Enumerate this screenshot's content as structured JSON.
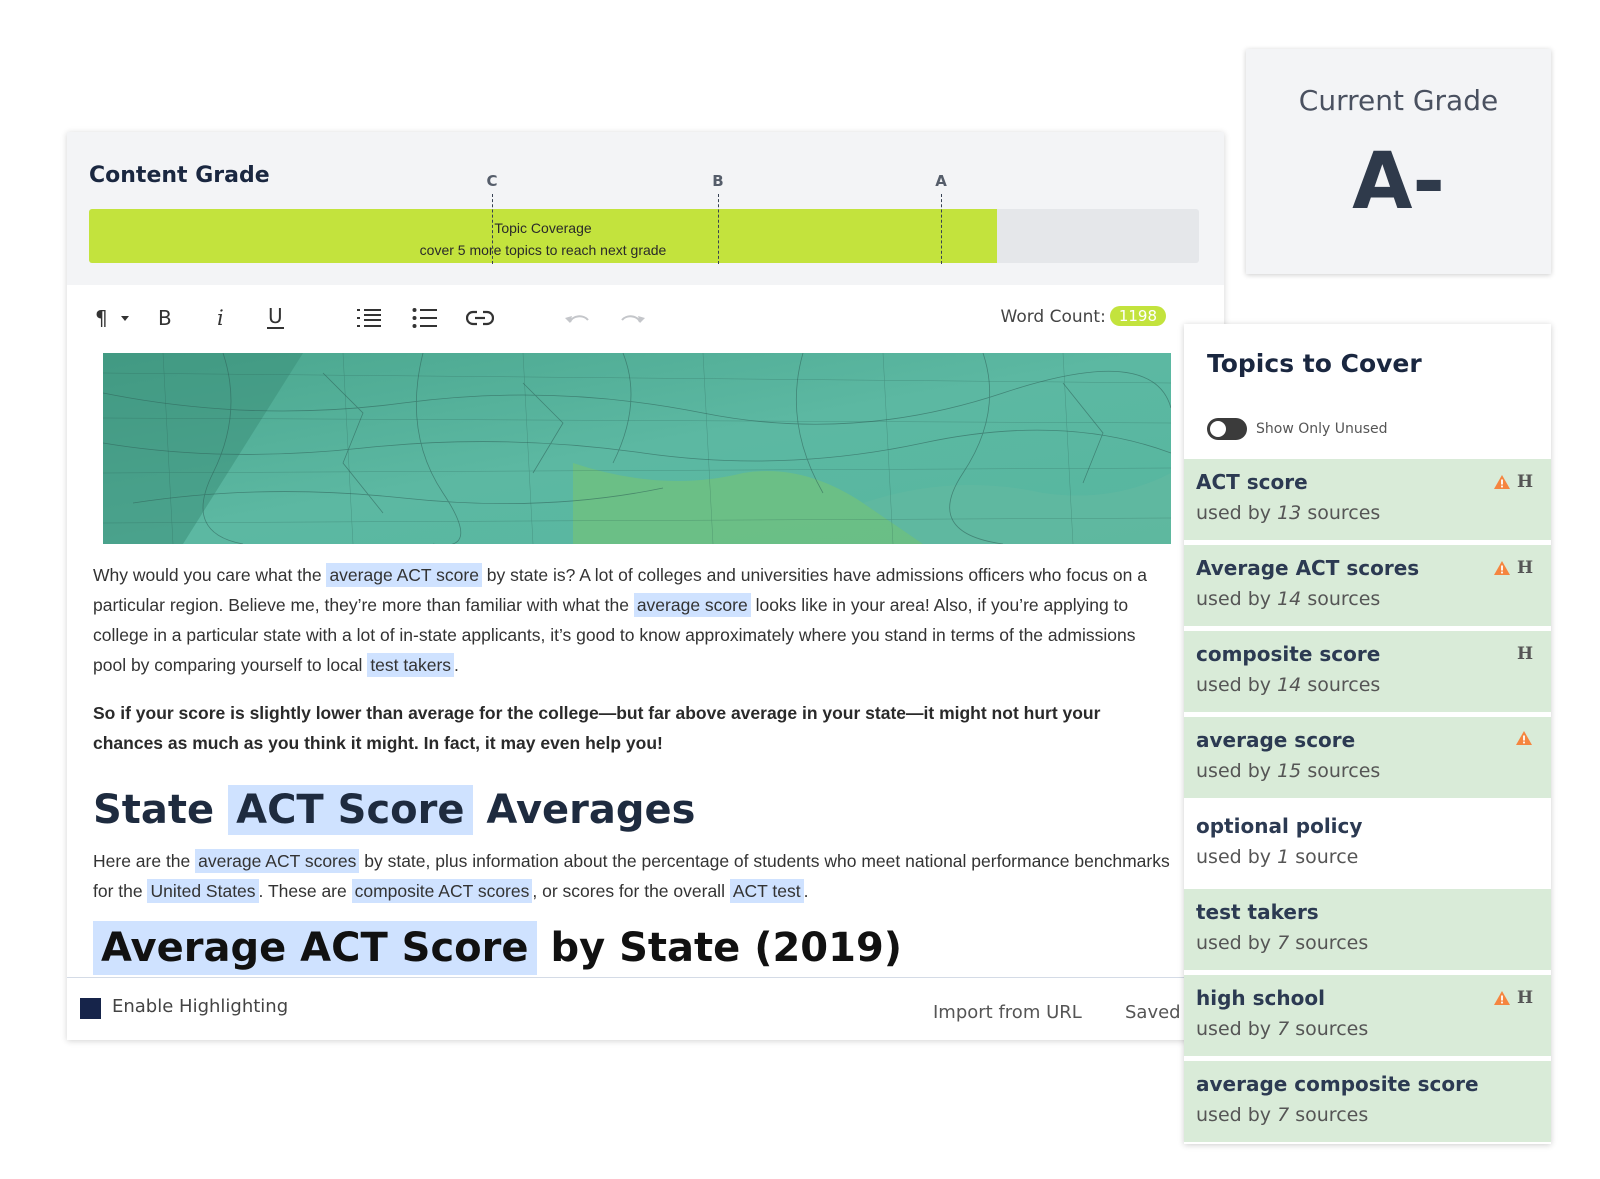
{
  "content_grade": {
    "title": "Content Grade",
    "markers": [
      {
        "label": "C"
      },
      {
        "label": "B"
      },
      {
        "label": "A"
      }
    ],
    "bar": {
      "label": "Topic Coverage",
      "sublabel": "cover 5 more topics to reach next grade",
      "fill_percent": 81.8,
      "color": "#c3e33d"
    }
  },
  "toolbar": {
    "paragraph_icon": "paragraph-icon",
    "buttons": [
      {
        "name": "bold-icon",
        "glyph": "B"
      },
      {
        "name": "italic-icon",
        "glyph": "i"
      },
      {
        "name": "underline-icon",
        "glyph": "U"
      },
      {
        "name": "ordered-list-icon"
      },
      {
        "name": "bulleted-list-icon"
      },
      {
        "name": "link-icon"
      },
      {
        "name": "undo-icon"
      },
      {
        "name": "redo-icon"
      }
    ],
    "word_count_label": "Word Count:",
    "word_count": "1198"
  },
  "article": {
    "intro": {
      "t1": "Why would you care what the ",
      "h1": "average ACT score",
      "t2": " by state is? A lot of colleges and universities have admissions officers who focus on a particular region. Believe me, they’re more than familiar with what the ",
      "h2": "average score",
      "t3": " looks like in your area! Also, if you’re applying to college in a particular state with a lot of in-state applicants, it’s good to know approximately where you stand in terms of the admissions pool by comparing yourself to local ",
      "h3": "test takers",
      "t4": "."
    },
    "bold_para": "So if your score is slightly lower than average for the college—but far above average in your state—it might not hurt your chances as much as you think it might. In fact, it may even help you!",
    "heading2": {
      "pre": "State ",
      "hl": "ACT Score",
      "post": " Averages"
    },
    "para2": {
      "t1": "Here are the ",
      "h1": "average ACT scores",
      "t2": " by state, plus information about the percentage of students who meet national performance benchmarks for the ",
      "h2": "United States",
      "t3": ". These are ",
      "h3": "composite ACT scores",
      "t4": ", or scores for the overall ",
      "h4": "ACT test",
      "t5": "."
    },
    "heading3": {
      "hl": "Average ACT Score",
      "post": " by State (2019)"
    }
  },
  "footer": {
    "enable_highlighting": "Enable Highlighting",
    "import_url": "Import from URL",
    "saved": "Saved"
  },
  "current_grade": {
    "label": "Current Grade",
    "value": "A-"
  },
  "topics": {
    "title": "Topics to Cover",
    "toggle_label": "Show Only Unused",
    "items": [
      {
        "name": "ACT score",
        "used_by": "used by",
        "count": "13",
        "unit": "sources",
        "used": true,
        "warning": true,
        "heading": true
      },
      {
        "name": "Average ACT scores",
        "used_by": "used by",
        "count": "14",
        "unit": "sources",
        "used": true,
        "warning": true,
        "heading": true
      },
      {
        "name": "composite score",
        "used_by": "used by",
        "count": "14",
        "unit": "sources",
        "used": true,
        "warning": false,
        "heading": true
      },
      {
        "name": "average score",
        "used_by": "used by",
        "count": "15",
        "unit": "sources",
        "used": true,
        "warning": true,
        "heading": false
      },
      {
        "name": "optional policy",
        "used_by": "used by",
        "count": "1",
        "unit": "source",
        "used": false,
        "warning": false,
        "heading": false
      },
      {
        "name": "test takers",
        "used_by": "used by",
        "count": "7",
        "unit": "sources",
        "used": true,
        "warning": false,
        "heading": false
      },
      {
        "name": "high school",
        "used_by": "used by",
        "count": "7",
        "unit": "sources",
        "used": true,
        "warning": true,
        "heading": true
      },
      {
        "name": "average composite score",
        "used_by": "used by",
        "count": "7",
        "unit": "sources",
        "used": true,
        "warning": false,
        "heading": false
      }
    ],
    "heading_badge": "H",
    "used_color": "#d9ebd8",
    "warning_color": "#f5853f"
  }
}
